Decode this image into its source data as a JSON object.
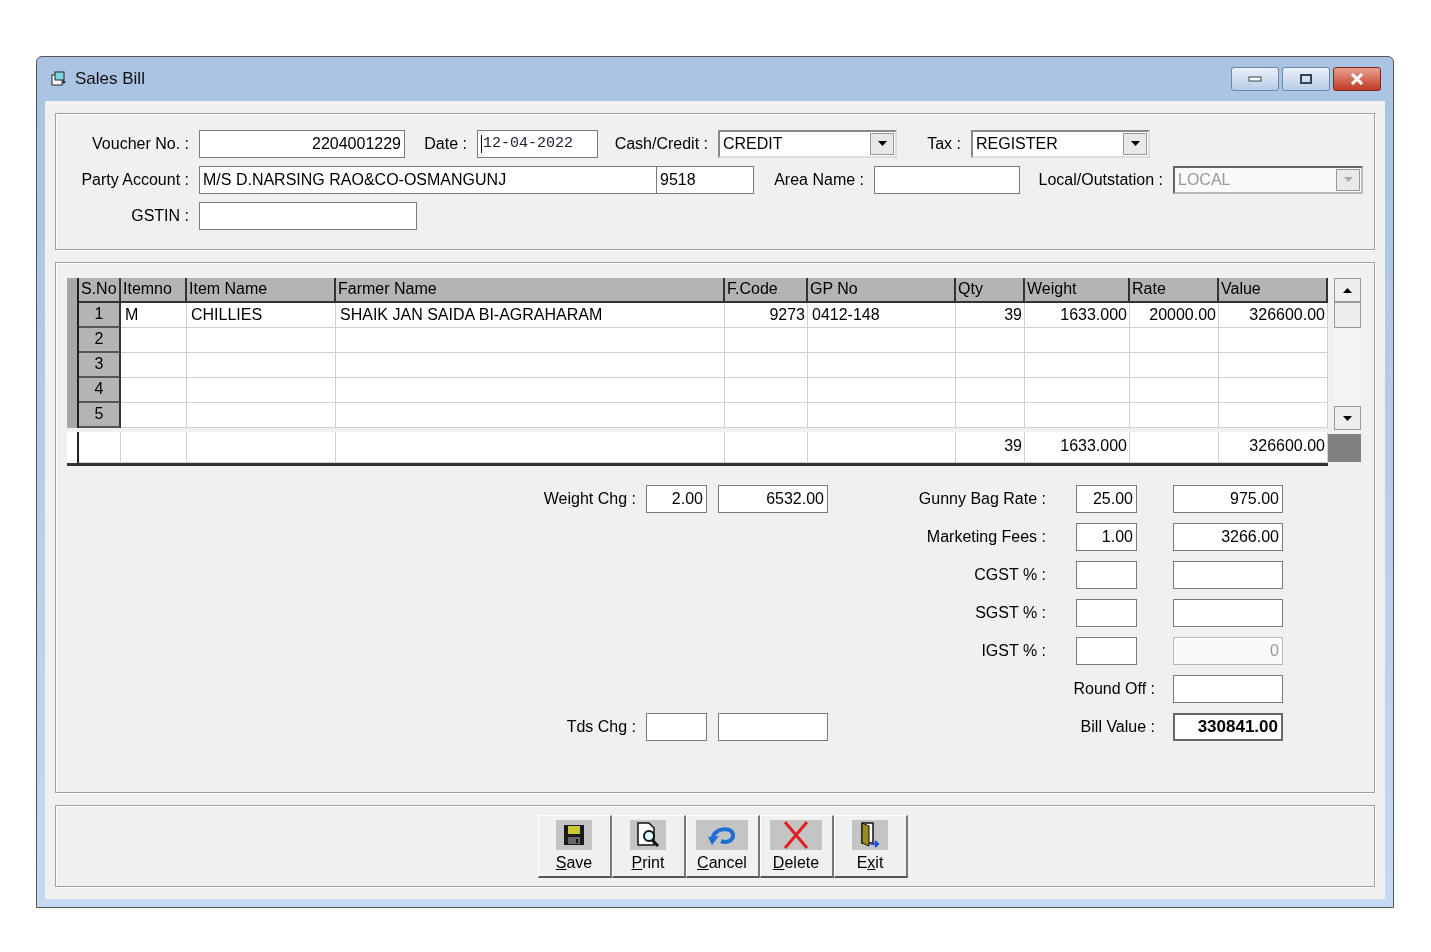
{
  "window": {
    "title": "Sales Bill"
  },
  "form": {
    "voucher_no": {
      "label": "Voucher No. :",
      "value": "2204001229"
    },
    "date": {
      "label": "Date :",
      "value": "12-04-2022",
      "focused": true
    },
    "cash_credit": {
      "label": "Cash/Credit :",
      "value": "CREDIT",
      "disabled": false
    },
    "tax": {
      "label": "Tax :",
      "value": "REGISTER",
      "disabled": false
    },
    "party_account": {
      "label": "Party Account :",
      "value": "M/S D.NARSING RAO&CO-OSMANGUNJ",
      "code": "9518"
    },
    "area_name": {
      "label": "Area Name :"
    },
    "local_outstation": {
      "label": "Local/Outstation :",
      "value": "LOCAL",
      "disabled": true
    },
    "gstin": {
      "label": "GSTIN :"
    }
  },
  "table": {
    "columns": [
      "S.No",
      "Itemno",
      "Item Name",
      "Farmer Name",
      "F.Code",
      "GP No",
      "Qty",
      "Weight",
      "Rate",
      "Value"
    ],
    "rows": [
      {
        "sno": "1",
        "cells": [
          "M",
          "CHILLIES",
          "SHAIK JAN SAIDA BI-AGRAHARAM",
          "9273",
          "0412-148",
          "39",
          "1633.000",
          "20000.00",
          "326600.00"
        ]
      },
      {
        "sno": "2"
      },
      {
        "sno": "3"
      },
      {
        "sno": "4"
      },
      {
        "sno": "5"
      }
    ],
    "totals": {
      "qty": "39",
      "weight": "1633.000",
      "value": "326600.00"
    }
  },
  "left_charges": [
    {
      "label": "Weight Chg :",
      "rate": "2.00",
      "amount": "6532.00"
    },
    {
      "label": "Tds Chg :"
    }
  ],
  "right_charges": [
    {
      "kind": "rate_amount",
      "label": "Gunny Bag Rate :",
      "rate": "25.00",
      "amount": "975.00",
      "amount_disabled": false,
      "emphasis": false
    },
    {
      "kind": "rate_amount",
      "label": "Marketing Fees :",
      "rate": "1.00",
      "amount": "3266.00",
      "amount_disabled": false,
      "emphasis": false
    },
    {
      "kind": "rate_amount",
      "label": "CGST % :",
      "amount_disabled": false,
      "emphasis": false
    },
    {
      "kind": "rate_amount",
      "label": "SGST % :",
      "amount_disabled": false,
      "emphasis": false
    },
    {
      "kind": "rate_amount",
      "label": "IGST % :",
      "amount": "0",
      "amount_disabled": true,
      "emphasis": false
    },
    {
      "kind": "amount_only",
      "label": "Round Off :",
      "amount_disabled": false,
      "emphasis": false
    },
    {
      "kind": "amount_only",
      "label": "Bill Value :",
      "amount": "330841.00",
      "amount_disabled": false,
      "emphasis": true
    }
  ],
  "buttons": [
    {
      "kind": "save",
      "access_key": "S",
      "label_rest": "ave"
    },
    {
      "kind": "print",
      "access_key": "P",
      "label_rest": "rint"
    },
    {
      "kind": "cancel",
      "access_key": "C",
      "label_rest": "ancel"
    },
    {
      "kind": "delete",
      "access_key": "D",
      "label_rest": "elete"
    },
    {
      "kind": "exit",
      "label_start": "E",
      "access_key": "x",
      "label_rest": "it"
    }
  ]
}
